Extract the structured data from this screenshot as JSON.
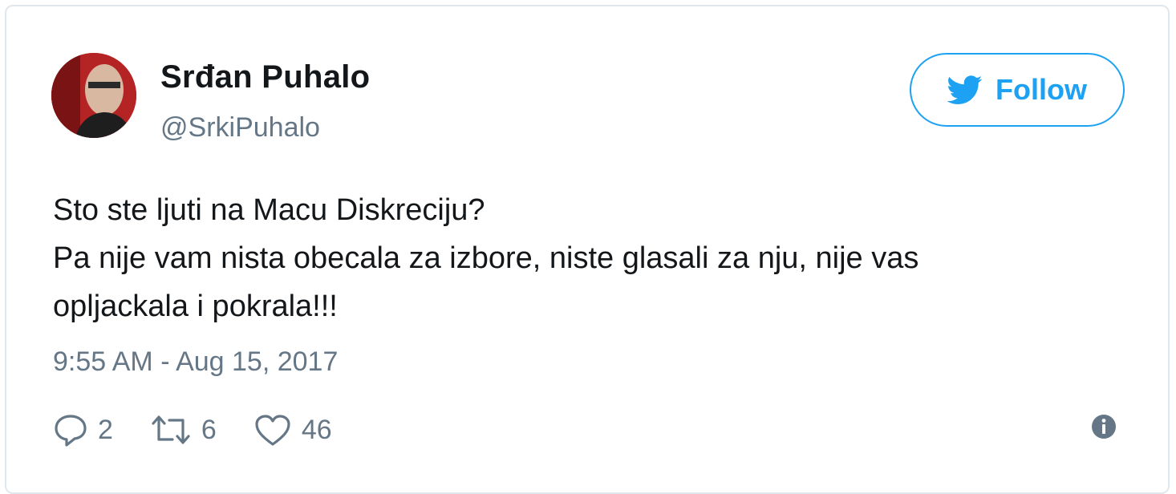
{
  "author": {
    "name": "Srđan Puhalo",
    "handle": "@SrkiPuhalo"
  },
  "follow_button": {
    "label": "Follow",
    "icon": "twitter-bird-icon"
  },
  "tweet": {
    "lines": [
      "Sto ste ljuti na Macu Diskreciju?",
      "Pa nije vam nista obecala za izbore, niste glasali za nju, nije vas",
      "opljackala i pokrala!!!"
    ],
    "timestamp": "9:55 AM - Aug 15, 2017"
  },
  "actions": {
    "replies": {
      "icon": "reply-icon",
      "count": "2"
    },
    "retweets": {
      "icon": "retweet-icon",
      "count": "6"
    },
    "likes": {
      "icon": "heart-icon",
      "count": "46"
    },
    "info": {
      "icon": "info-icon"
    }
  },
  "colors": {
    "accent": "#1da1f2",
    "text": "#14171a",
    "secondary": "#657786",
    "border": "#e1e8ed"
  }
}
